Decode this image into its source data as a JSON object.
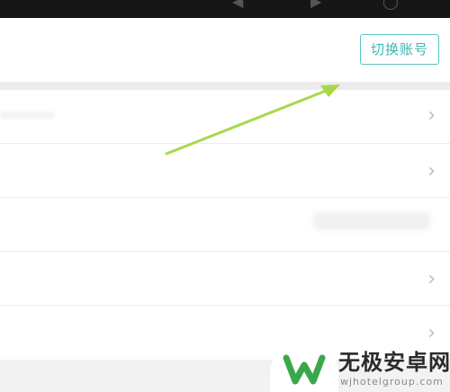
{
  "header": {
    "switch_account_label": "切换账号"
  },
  "icons": {
    "row_chevron": "chevron-right-icon",
    "status_back": "back-icon",
    "status_forward": "forward-icon",
    "status_refresh": "refresh-icon"
  },
  "list": {
    "chevron_glyph": "›",
    "rows": [
      {
        "label": ""
      },
      {
        "label": ""
      },
      {
        "label": ""
      },
      {
        "label": ""
      },
      {
        "label": ""
      }
    ]
  },
  "annotation": {
    "arrow_color": "#a6d94a"
  },
  "watermark": {
    "title": "无极安卓网",
    "url": "wjhotelgroup.com",
    "logo_color": "#3aa84a"
  },
  "colors": {
    "accent": "#3fb5b1",
    "status_bar": "#161616",
    "background": "#f2f2f2"
  }
}
